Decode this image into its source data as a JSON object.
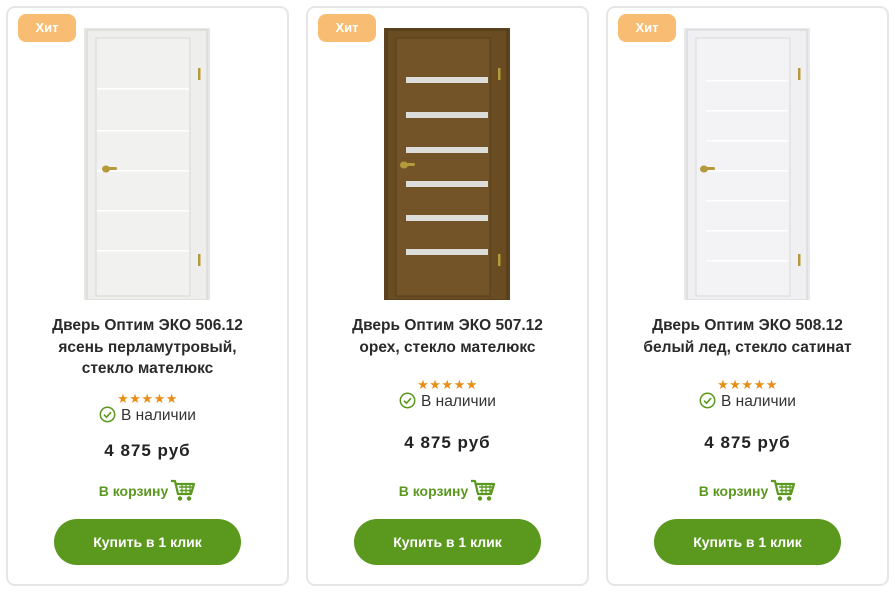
{
  "products": [
    {
      "badge": "Хит",
      "title_lines": [
        "Дверь Оптим ЭКО 506.12",
        "ясень перламутровый,",
        "стекло мателюкс"
      ],
      "door_color": "#ececea",
      "rating_stars": 5,
      "stock": "В наличии",
      "price": "4 875 руб",
      "cart_label": "В корзину",
      "buy_label": "Купить в 1 клик"
    },
    {
      "badge": "Хит",
      "title_lines": [
        "Дверь Оптим ЭКО 507.12",
        "орех, стекло мателюкс"
      ],
      "door_color": "#6e5126",
      "rating_stars": 5,
      "stock": "В наличии",
      "price": "4 875 руб",
      "cart_label": "В корзину",
      "buy_label": "Купить в 1 клик"
    },
    {
      "badge": "Хит",
      "title_lines": [
        "Дверь Оптим ЭКО 508.12",
        "белый лед, стекло сатинат"
      ],
      "door_color": "#f0f0f2",
      "rating_stars": 5,
      "stock": "В наличии",
      "price": "4 875 руб",
      "cart_label": "В корзину",
      "buy_label": "Купить в 1 клик"
    }
  ],
  "colors": {
    "badge": "#f8bd73",
    "accent_green": "#5a981e",
    "star": "#e98d14",
    "card_border": "#e6e6e6"
  },
  "icons": {
    "stock": "check-circle-icon",
    "cart": "shopping-cart-icon",
    "rating": "star-icon"
  }
}
